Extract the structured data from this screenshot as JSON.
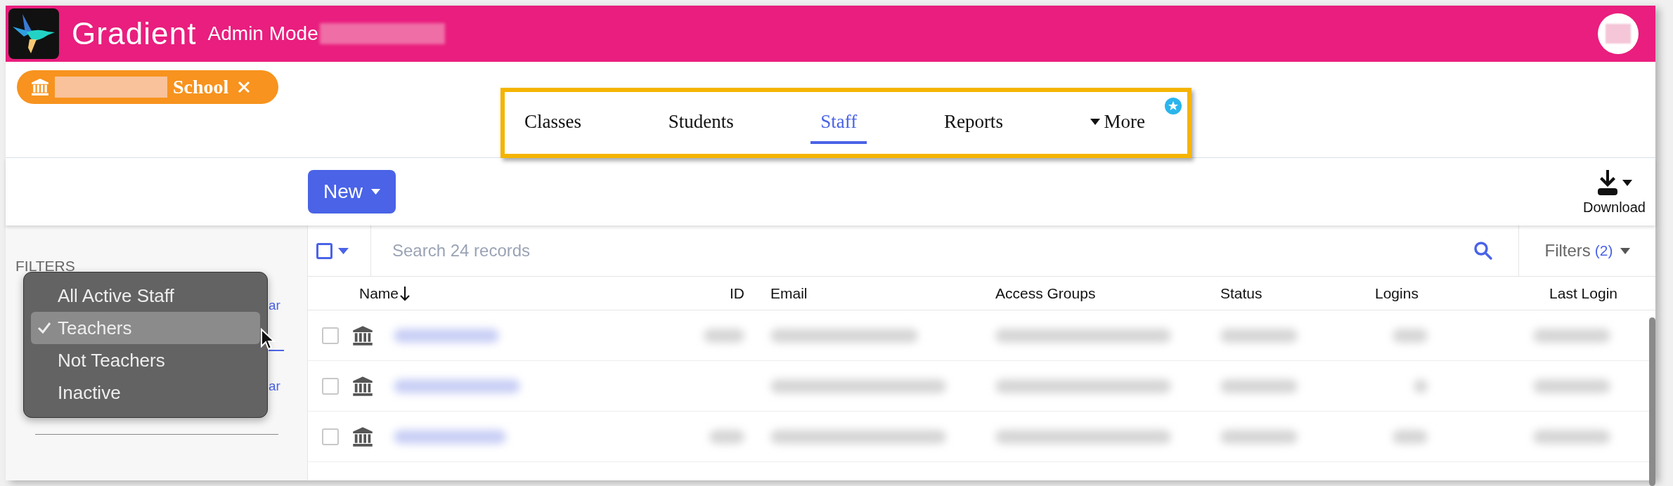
{
  "header": {
    "app_name": "Gradient",
    "mode": "Admin Mode"
  },
  "school_chip": {
    "label": "School"
  },
  "nav": [
    {
      "label": "Classes",
      "selected": false,
      "kind": "tab"
    },
    {
      "label": "Students",
      "selected": false,
      "kind": "tab"
    },
    {
      "label": "Staff",
      "selected": true,
      "kind": "tab"
    },
    {
      "label": "Reports",
      "selected": false,
      "kind": "tab"
    },
    {
      "label": "More",
      "selected": false,
      "kind": "dropdown"
    }
  ],
  "new_button": "New",
  "download": "Download",
  "filters": {
    "title": "FILTERS",
    "links": [
      "ar",
      "ar"
    ]
  },
  "menu": [
    {
      "label": "All Active Staff",
      "selected": false
    },
    {
      "label": "Teachers",
      "selected": true
    },
    {
      "label": "Not Teachers",
      "selected": false
    },
    {
      "label": "Inactive",
      "selected": false
    }
  ],
  "search": {
    "placeholder": "Search 24 records"
  },
  "select_all": {
    "checked": false
  },
  "filters_button": {
    "label": "Filters",
    "count": "(2)"
  },
  "table": {
    "columns": [
      {
        "label": "Name",
        "sorted": true
      },
      {
        "label": "ID",
        "sorted": false
      },
      {
        "label": "Email",
        "sorted": false
      },
      {
        "label": "Access Groups",
        "sorted": false
      },
      {
        "label": "Status",
        "sorted": false
      },
      {
        "label": "Logins",
        "sorted": false
      },
      {
        "label": "Last Login",
        "sorted": false
      }
    ],
    "rows": [
      {
        "checked": false
      },
      {
        "checked": false
      },
      {
        "checked": false
      }
    ]
  }
}
